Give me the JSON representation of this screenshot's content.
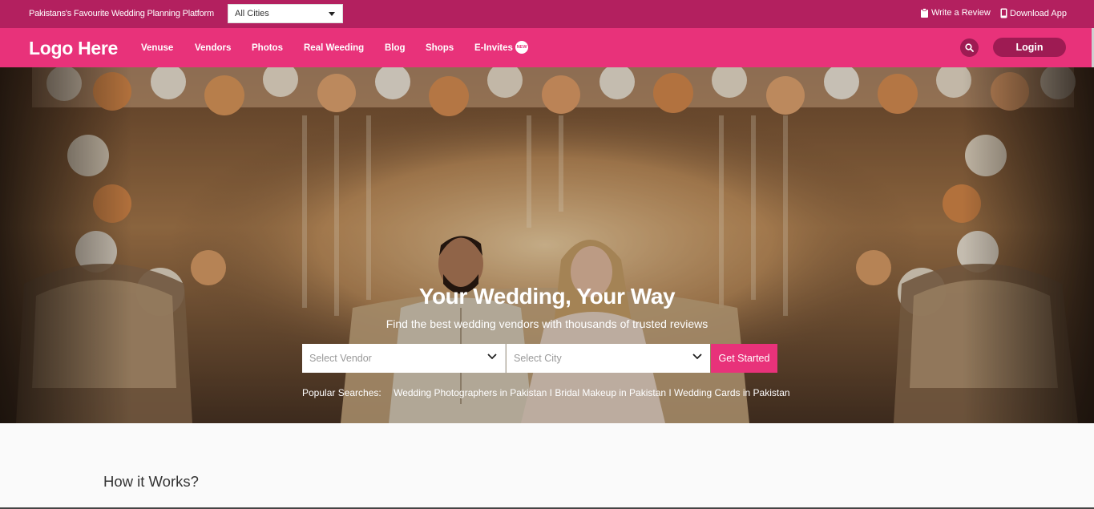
{
  "topbar": {
    "tagline": "Pakistans's Favourite Wedding Planning Platform",
    "city_select_value": "All Cities",
    "write_review": "Write a Review",
    "download_app": "Download App"
  },
  "nav": {
    "logo": "Logo Here",
    "items": [
      "Venuse",
      "Vendors",
      "Photos",
      "Real Weeding",
      "Blog",
      "Shops",
      "E-Invites"
    ],
    "new_badge": "NEW",
    "login": "Login"
  },
  "hero": {
    "title": "Your Wedding, Your Way",
    "subtitle": "Find the best wedding vendors with thousands of trusted reviews",
    "vendor_placeholder": "Select Vendor",
    "city_placeholder": "Select City",
    "cta": "Get Started",
    "popular_label": "Popular Searches:",
    "popular_links": "Wedding Photographers in Pakistan I Bridal Makeup in Pakistan I Wedding Cards in Pakistan"
  },
  "section": {
    "how_title": "How it Works?"
  },
  "colors": {
    "topbar": "#b3205f",
    "navbar": "#e8327a",
    "accent_dark": "#9e1b53",
    "cta": "#e8327a"
  }
}
